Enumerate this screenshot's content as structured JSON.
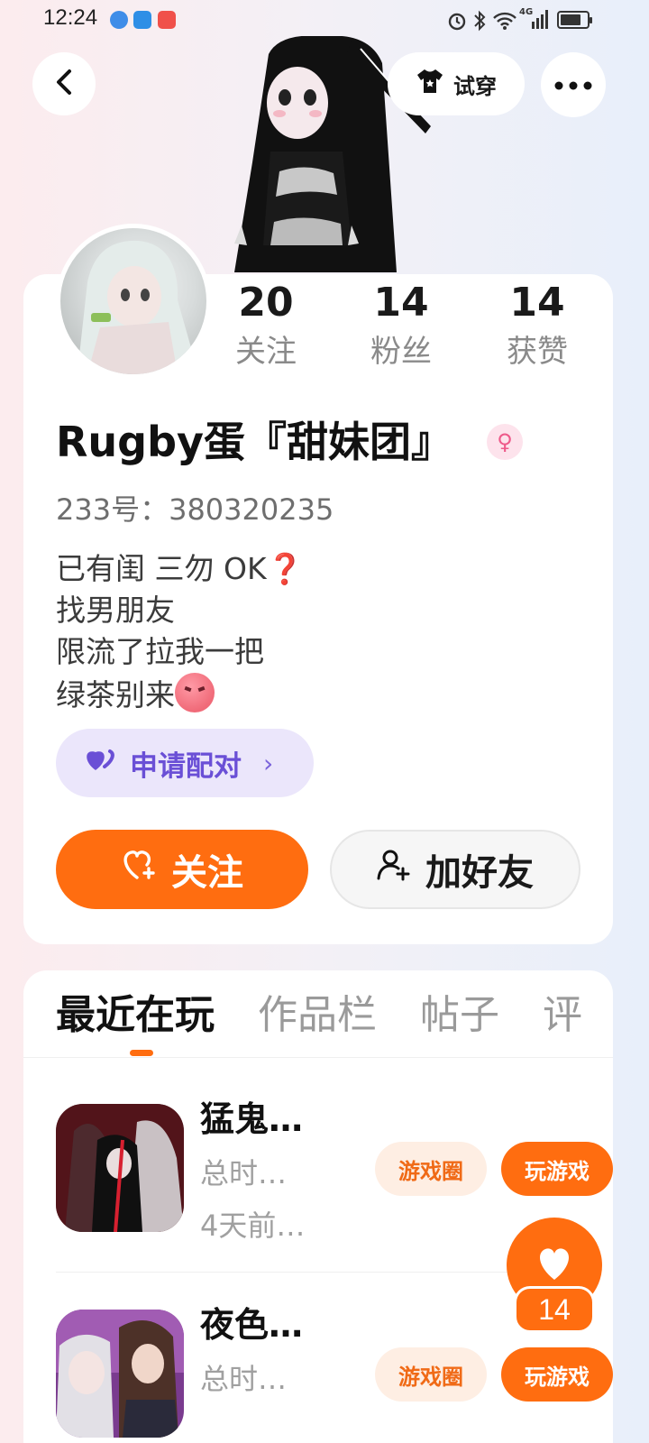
{
  "status_bar": {
    "time": "12:24",
    "icons": [
      "browser-icon",
      "weather-icon",
      "app-icon",
      "alarm-icon",
      "bluetooth-icon",
      "wifi-icon",
      "signal-4g-icon",
      "battery-icon"
    ],
    "network_label": "4G"
  },
  "header": {
    "tryon_label": "试穿",
    "icons": [
      "back-icon",
      "tshirt-icon",
      "more-icon"
    ]
  },
  "profile": {
    "stats": [
      {
        "value": "20",
        "label": "关注"
      },
      {
        "value": "14",
        "label": "粉丝"
      },
      {
        "value": "14",
        "label": "获赞"
      }
    ],
    "username": "Rugby蛋『甜妹团』",
    "gender_symbol": "♀",
    "uid_text": "233号：380320235",
    "bio": {
      "line1": "已有闺 三勿 OK",
      "line1_emoji": "❓",
      "line2": "找男朋友",
      "line3": "限流了拉我一把",
      "line4": "绿茶别来"
    },
    "match_label": "申请配对",
    "follow_label": "关注",
    "add_friend_label": "加好友",
    "colors": {
      "accent": "#ff6d10",
      "match": "#6a4fd6",
      "match_bg": "#ebe6fb"
    }
  },
  "tabs": [
    {
      "label": "最近在玩",
      "active": true
    },
    {
      "label": "作品栏",
      "active": false
    },
    {
      "label": "帖子",
      "active": false
    },
    {
      "label": "评",
      "active": false
    }
  ],
  "games": [
    {
      "title": "猛鬼…",
      "playtime": "总时…",
      "last_played": "4天前…",
      "circle_label": "游戏圈",
      "play_label": "玩游戏"
    },
    {
      "title": "夜色…",
      "playtime": "总时…",
      "circle_label": "游戏圈",
      "play_label": "玩游戏"
    }
  ],
  "like_fab": {
    "count": "14"
  }
}
